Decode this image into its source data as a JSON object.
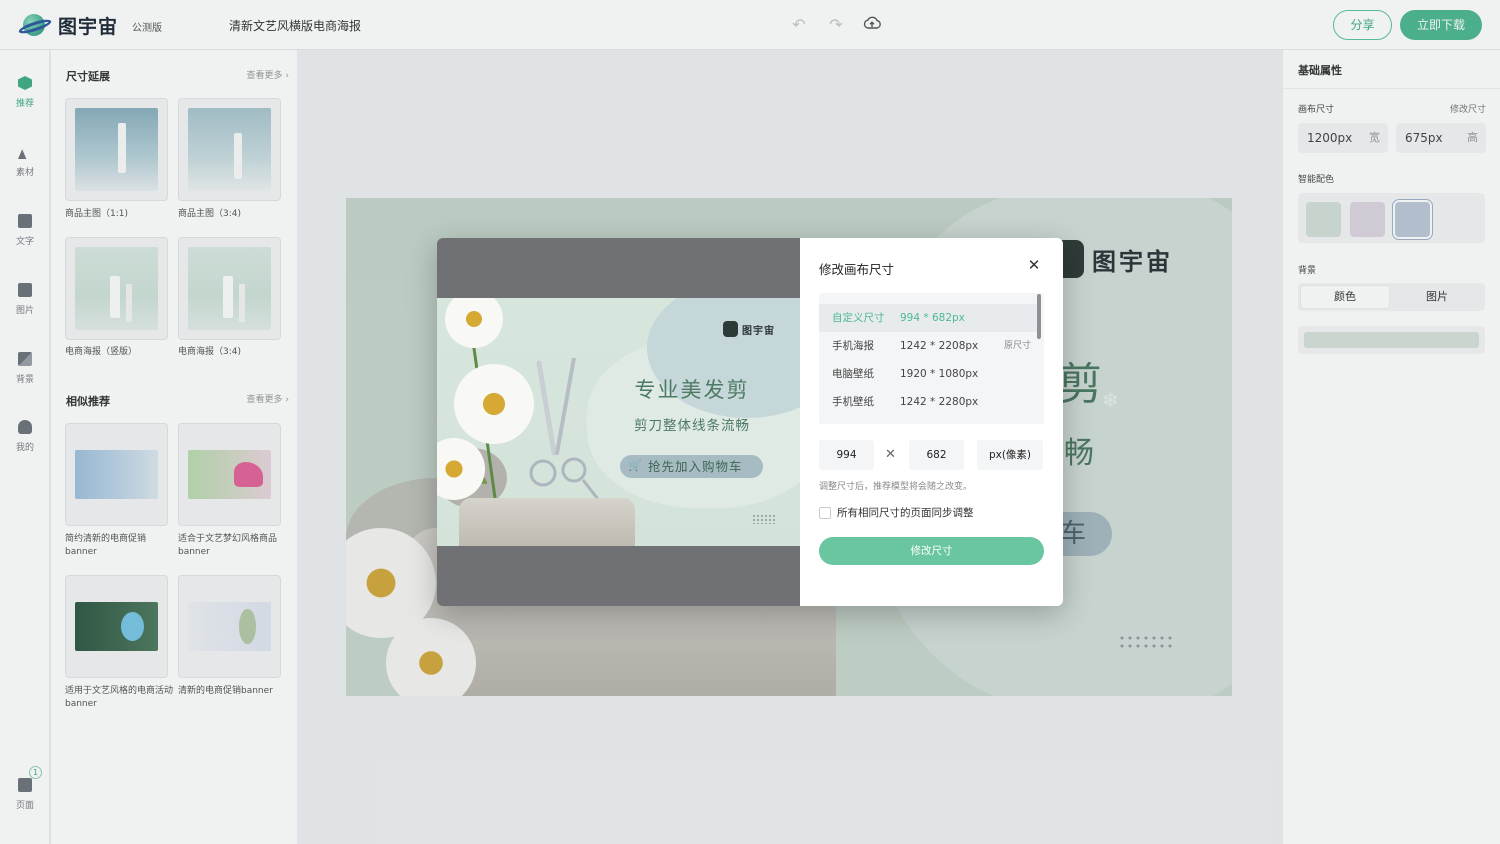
{
  "header": {
    "app_name": "图宇宙",
    "beta_label": "公测版",
    "document_title": "清新文艺风横版电商海报",
    "share_label": "分享",
    "download_label": "立即下载"
  },
  "rail": {
    "items": [
      {
        "label": "推荐",
        "icon": "recommend-icon",
        "active": true
      },
      {
        "label": "素材",
        "icon": "material-icon"
      },
      {
        "label": "文字",
        "icon": "text-icon"
      },
      {
        "label": "图片",
        "icon": "image-icon"
      },
      {
        "label": "背景",
        "icon": "background-icon"
      },
      {
        "label": "我的",
        "icon": "user-icon"
      }
    ],
    "pages_label": "页面",
    "pages_count": "1"
  },
  "left_panel": {
    "size_section": {
      "title": "尺寸延展",
      "more_label": "查看更多",
      "items": [
        {
          "caption": "商品主图（1:1)"
        },
        {
          "caption": "商品主图（3:4)"
        },
        {
          "caption": "电商海报（竖版）"
        },
        {
          "caption": "电商海报（3:4)"
        }
      ]
    },
    "similar_section": {
      "title": "相似推荐",
      "more_label": "查看更多",
      "items": [
        {
          "caption": "简约清新的电商促销banner"
        },
        {
          "caption": "适合于文艺梦幻风格商品banner"
        },
        {
          "caption": "适用于文艺风格的电商活动banner"
        },
        {
          "caption": "清新的电商促销banner"
        }
      ]
    }
  },
  "canvas": {
    "brand": "图宇宙",
    "char_big": "剪",
    "char_mid": "畅",
    "char_cart": "车"
  },
  "right_panel": {
    "title": "基础属性",
    "canvas_size_label": "画布尺寸",
    "resize_link": "修改尺寸",
    "width_value": "1200px",
    "width_unit": "宽",
    "height_value": "675px",
    "height_unit": "高",
    "smart_color_label": "智能配色",
    "swatch_colors": [
      "#d3e0d9",
      "#dcd5df",
      "#bcc8d6"
    ],
    "background_label": "背景",
    "bg_tab_color": "颜色",
    "bg_tab_image": "图片",
    "background_color": "#d5e1da"
  },
  "modal": {
    "title": "修改画布尺寸",
    "presets": [
      {
        "name": "自定义尺寸",
        "size": "994 * 682px",
        "tag": "",
        "active": true
      },
      {
        "name": "手机海报",
        "size": "1242 * 2208px",
        "tag": "原尺寸"
      },
      {
        "name": "电脑壁纸",
        "size": "1920 * 1080px",
        "tag": ""
      },
      {
        "name": "手机壁纸",
        "size": "1242 * 2280px",
        "tag": ""
      }
    ],
    "width_input": "994",
    "height_input": "682",
    "unit_label": "px(像素)",
    "hint": "调整尺寸后，推荐模型将会随之改变。",
    "sync_label": "所有相同尺寸的页面同步调整",
    "submit_label": "修改尺寸",
    "preview": {
      "brand": "图宇宙",
      "headline": "专业美发剪",
      "subline": "剪刀整体线条流畅",
      "cta": "抢先加入购物车"
    }
  }
}
